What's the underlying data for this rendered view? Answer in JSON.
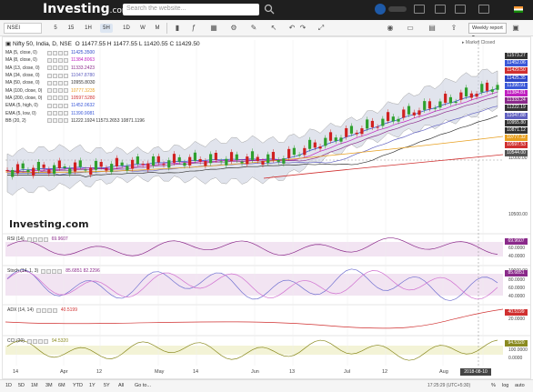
{
  "header": {
    "logo_text": "Investing",
    "logo_suffix": ".com",
    "search_placeholder": "Search the website..."
  },
  "toolbar": {
    "symbol": "NSEI",
    "timeframes": [
      "5",
      "15",
      "1H",
      "5H",
      "1D",
      "W",
      "M"
    ],
    "weekly_report_label": "Weekly report"
  },
  "chart": {
    "title": "Nifty 50, India, D, NSE",
    "ohlc": "O 11477.55  H 11477.55  L 11420.55  C 11429.50",
    "market_status": "Market Closed",
    "indicators": [
      {
        "name": "MA (5, close, 0)",
        "value": "11425.3500",
        "color": "#2d46c8"
      },
      {
        "name": "MA (8, close, 0)",
        "value": "11384.8063",
        "color": "#c020c0"
      },
      {
        "name": "MA (13, close, 0)",
        "value": "11333.2423",
        "color": "#8a2a8a"
      },
      {
        "name": "MA (34, close, 0)",
        "value": "11047.8780",
        "color": "#6060c0"
      },
      {
        "name": "MA (50, close, 0)",
        "value": "10955.8030",
        "color": "#333333"
      },
      {
        "name": "MA (100, close, 0)",
        "value": "10777.3235",
        "color": "#e8a020"
      },
      {
        "name": "MA (200, close, 0)",
        "value": "10597.5280",
        "color": "#d03030"
      },
      {
        "name": "EMA (5, high, 0)",
        "value": "11452.0632",
        "color": "#3a58d8"
      },
      {
        "name": "EMA (5, low, 0)",
        "value": "11390.9081",
        "color": "#3a58d8"
      },
      {
        "name": "BB (20, 2)",
        "value": "11222.1924  11573.2653  10871.1196",
        "color": "#333333"
      }
    ],
    "price_axis": [
      "11500.00",
      "11000.00",
      "10500.00",
      "10000.00"
    ],
    "price_tags": [
      {
        "label": "11573.27",
        "color": "#333333"
      },
      {
        "label": "11452.06",
        "color": "#3a58d8"
      },
      {
        "label": "11429.50",
        "color": "#d03030"
      },
      {
        "label": "11425.35",
        "color": "#2d46c8"
      },
      {
        "label": "11390.91",
        "color": "#3a58d8"
      },
      {
        "label": "11384.81",
        "color": "#c020c0"
      },
      {
        "label": "11333.24",
        "color": "#8a2a8a"
      },
      {
        "label": "11222.19",
        "color": "#333333"
      },
      {
        "label": "11047.88",
        "color": "#6060c0"
      },
      {
        "label": "10955.80",
        "color": "#333333"
      },
      {
        "label": "10871.12",
        "color": "#333333"
      },
      {
        "label": "10777.32",
        "color": "#e8a020"
      },
      {
        "label": "10597.53",
        "color": "#d03030"
      },
      {
        "label": "10544.00",
        "color": "#555555"
      }
    ],
    "panes": [
      {
        "name": "RSI (14)",
        "value": "69.9607",
        "tag": "69.9607",
        "axis": [
          "60.0000",
          "40.0000"
        ],
        "color": "#8a2a8a"
      },
      {
        "name": "Stoch (14, 1, 3)",
        "value": "85.6851  82.2296",
        "tag": "85.6851",
        "axis": [
          "80.0000",
          "60.0000",
          "40.0000"
        ],
        "color": "#8a2a8a"
      },
      {
        "name": "ADX (14, 14)",
        "value": "40.5199",
        "tag": "40.5199",
        "axis": [
          "20.0000"
        ],
        "color": "#d03030"
      },
      {
        "name": "CCI (20)",
        "value": "94.5320",
        "tag": "94.5320",
        "axis": [
          "100.0000",
          "0.0000"
        ],
        "color": "#8a8a20"
      }
    ],
    "x_labels": [
      "14",
      "Apr",
      "12",
      "May",
      "14",
      "Jun",
      "13",
      "Jul",
      "12",
      "Aug",
      "14"
    ],
    "current_date": "2018-08-10",
    "watermark": "Investing.com"
  },
  "bottom": {
    "ranges": [
      "1D",
      "5D",
      "1M",
      "3M",
      "6M",
      "YTD",
      "1Y",
      "5Y",
      "All",
      "Go to..."
    ],
    "status_time": "17:25:29 (UTC+5:30)",
    "options": [
      "%",
      "log",
      "auto"
    ]
  }
}
